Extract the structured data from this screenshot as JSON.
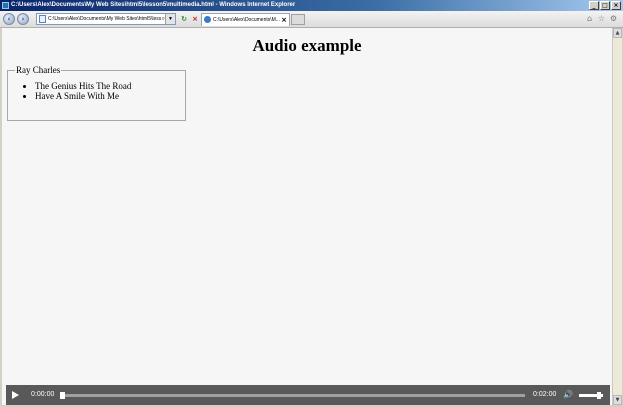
{
  "window": {
    "title": "C:\\Users\\Alex\\Documents\\My Web Sites\\html5\\lesson5\\multimedia.html - Windows Internet Explorer",
    "minimize_glyph": "_",
    "maximize_glyph": "□",
    "close_glyph": "×"
  },
  "toolbar": {
    "back_glyph": "‹",
    "forward_glyph": "›",
    "address_value": "C:\\Users\\Alex\\Documents\\My Web Sites\\html5\\less",
    "search_glyph": "⌕",
    "dropdown_glyph": "▼",
    "refresh_glyph": "↻",
    "stop_glyph": "×",
    "tab_title": "C:\\Users\\Alex\\Documents\\M...",
    "tab_close_glyph": "×",
    "home_glyph": "⌂",
    "favorites_glyph": "☆",
    "tools_glyph": "⚙"
  },
  "page": {
    "title": "Audio example",
    "fieldset": {
      "legend": "Ray Charles",
      "songs": [
        "The Genius Hits The Road",
        "Have A Smile With Me"
      ]
    }
  },
  "scrollbar": {
    "up_glyph": "▲",
    "down_glyph": "▼"
  },
  "media": {
    "current_time": "0:00:00",
    "duration": "0:02:00",
    "progress": 0,
    "volume_glyph": "🔊",
    "volume_level": 0.85
  }
}
